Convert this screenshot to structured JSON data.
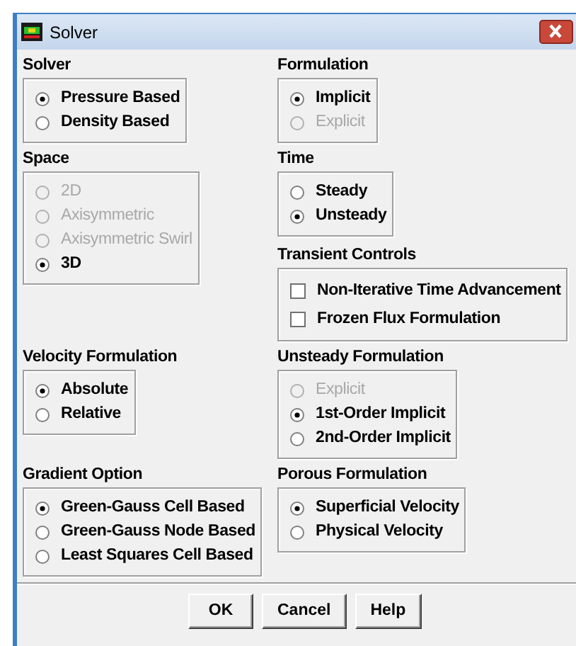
{
  "window": {
    "title": "Solver"
  },
  "rows": [
    {
      "left": [
        {
          "title": "Solver",
          "options": [
            {
              "kind": "radio",
              "label": "Pressure Based",
              "selected": true,
              "disabled": false
            },
            {
              "kind": "radio",
              "label": "Density Based",
              "selected": false,
              "disabled": false
            }
          ]
        }
      ],
      "right": [
        {
          "title": "Formulation",
          "options": [
            {
              "kind": "radio",
              "label": "Implicit",
              "selected": true,
              "disabled": false
            },
            {
              "kind": "radio",
              "label": "Explicit",
              "selected": false,
              "disabled": true
            }
          ]
        }
      ]
    },
    {
      "left": [
        {
          "title": "Space",
          "options": [
            {
              "kind": "radio",
              "label": "2D",
              "selected": false,
              "disabled": true
            },
            {
              "kind": "radio",
              "label": "Axisymmetric",
              "selected": false,
              "disabled": true
            },
            {
              "kind": "radio",
              "label": "Axisymmetric Swirl",
              "selected": false,
              "disabled": true
            },
            {
              "kind": "radio",
              "label": "3D",
              "selected": true,
              "disabled": false
            }
          ]
        }
      ],
      "right": [
        {
          "title": "Time",
          "options": [
            {
              "kind": "radio",
              "label": "Steady",
              "selected": false,
              "disabled": false
            },
            {
              "kind": "radio",
              "label": "Unsteady",
              "selected": true,
              "disabled": false
            }
          ]
        },
        {
          "title": "Transient Controls",
          "options": [
            {
              "kind": "checkbox",
              "label": "Non-Iterative Time Advancement",
              "checked": false
            },
            {
              "kind": "checkbox",
              "label": "Frozen Flux Formulation",
              "checked": false
            }
          ]
        }
      ]
    },
    {
      "left": [
        {
          "title": "Velocity Formulation",
          "options": [
            {
              "kind": "radio",
              "label": "Absolute",
              "selected": true,
              "disabled": false
            },
            {
              "kind": "radio",
              "label": "Relative",
              "selected": false,
              "disabled": false
            }
          ]
        }
      ],
      "right": [
        {
          "title": "Unsteady Formulation",
          "options": [
            {
              "kind": "radio",
              "label": "Explicit",
              "selected": false,
              "disabled": true
            },
            {
              "kind": "radio",
              "label": "1st-Order Implicit",
              "selected": true,
              "disabled": false
            },
            {
              "kind": "radio",
              "label": "2nd-Order Implicit",
              "selected": false,
              "disabled": false
            }
          ]
        }
      ]
    },
    {
      "left": [
        {
          "title": "Gradient Option",
          "options": [
            {
              "kind": "radio",
              "label": "Green-Gauss Cell Based",
              "selected": true,
              "disabled": false
            },
            {
              "kind": "radio",
              "label": "Green-Gauss Node Based",
              "selected": false,
              "disabled": false
            },
            {
              "kind": "radio",
              "label": "Least Squares Cell Based",
              "selected": false,
              "disabled": false
            }
          ]
        }
      ],
      "right": [
        {
          "title": "Porous Formulation",
          "options": [
            {
              "kind": "radio",
              "label": "Superficial Velocity",
              "selected": true,
              "disabled": false
            },
            {
              "kind": "radio",
              "label": "Physical Velocity",
              "selected": false,
              "disabled": false
            }
          ]
        }
      ]
    }
  ],
  "buttons": [
    "OK",
    "Cancel",
    "Help"
  ]
}
